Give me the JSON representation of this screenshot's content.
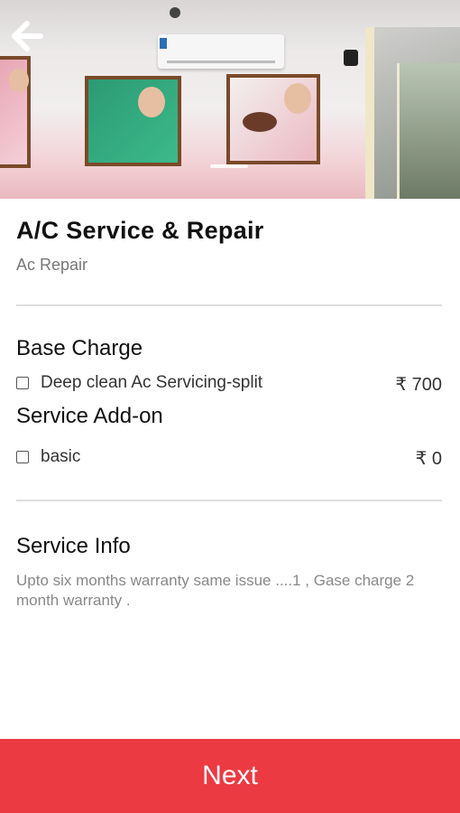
{
  "header": {
    "back_icon": "arrow-left-icon"
  },
  "service": {
    "title": "A/C Service & Repair",
    "category": "Ac Repair"
  },
  "base_charge": {
    "heading": "Base Charge",
    "options": [
      {
        "label": "Deep clean Ac Servicing-split",
        "price": "₹ 700",
        "checked": false
      }
    ]
  },
  "add_on": {
    "heading": "Service Add-on",
    "options": [
      {
        "label": "basic",
        "price": "₹ 0",
        "checked": false
      }
    ]
  },
  "info": {
    "heading": "Service Info",
    "text": "Upto six months warranty same issue ....1 , Gase charge 2 month warranty ."
  },
  "footer": {
    "next_label": "Next"
  },
  "colors": {
    "accent": "#eb3a42",
    "divider": "#dddddd",
    "muted_text": "#888888"
  }
}
